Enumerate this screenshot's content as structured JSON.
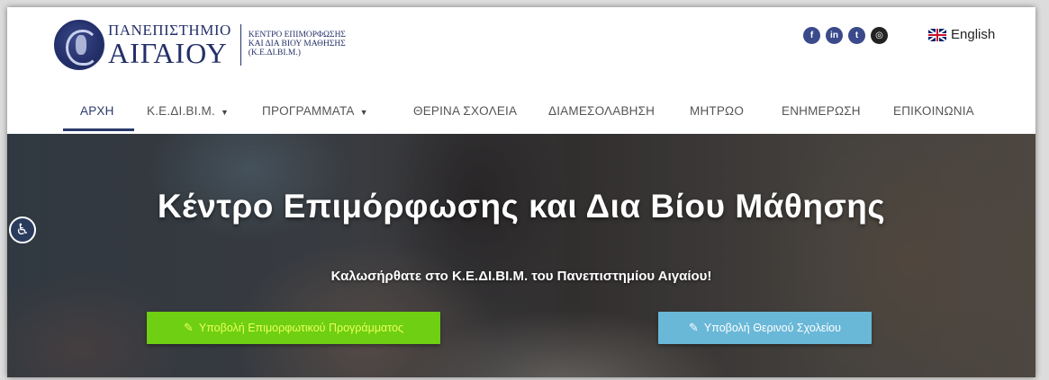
{
  "header": {
    "university_line1": "ΠΑΝΕΠΙΣΤΗΜΙΟ",
    "university_line2": "ΑΙΓΑΙΟΥ",
    "center_line1": "ΚΕΝΤΡΟ ΕΠΙΜΟΡΦΩΣΗΣ",
    "center_line2": "ΚΑΙ ΔΙΑ ΒΙΟΥ ΜΑΘΗΣΗΣ",
    "center_line3": "(Κ.Ε.ΔΙ.ΒΙ.Μ.)",
    "social": [
      {
        "icon": "facebook-icon",
        "glyph": "f"
      },
      {
        "icon": "linkedin-icon",
        "glyph": "in"
      },
      {
        "icon": "twitter-icon",
        "glyph": "t"
      },
      {
        "icon": "instagram-icon",
        "glyph": "◎"
      }
    ],
    "language_label": "English",
    "language_flag": "uk-flag-icon"
  },
  "nav": {
    "items": [
      {
        "label": "ΑΡΧΗ",
        "active": true,
        "dropdown": false
      },
      {
        "label": "Κ.Ε.ΔΙ.ΒΙ.Μ.",
        "active": false,
        "dropdown": true
      },
      {
        "label": "ΠΡΟΓΡΑΜΜΑΤΑ",
        "active": false,
        "dropdown": true
      },
      {
        "label": "ΘΕΡΙΝΑ ΣΧΟΛΕΙΑ",
        "active": false,
        "dropdown": false
      },
      {
        "label": "ΔΙΑΜΕΣΟΛΑΒΗΣΗ",
        "active": false,
        "dropdown": false
      },
      {
        "label": "ΜΗΤΡΩΟ",
        "active": false,
        "dropdown": false
      },
      {
        "label": "ΕΝΗΜΕΡΩΣΗ",
        "active": false,
        "dropdown": false
      },
      {
        "label": "ΕΠΙΚΟΙΝΩΝΙΑ",
        "active": false,
        "dropdown": false
      }
    ],
    "caret": "▼"
  },
  "hero": {
    "title": "Κέντρο Επιμόρφωσης και Δια Βίου Μάθησης",
    "subtitle": "Καλωσήρθατε στο Κ.Ε.ΔΙ.ΒΙ.Μ. του Πανεπιστημίου Αιγαίου!",
    "button_program": "Υποβολή Επιμορφωτικού Προγράμματος",
    "button_summer": "Υποβολή Θερινού Σχολείου",
    "button_icon": "✎"
  },
  "accessibility": {
    "icon": "accessibility-icon",
    "glyph": "♿"
  },
  "colors": {
    "brand_navy": "#24306a",
    "button_green": "#6fcf12",
    "button_green_text": "#e9ff5a",
    "button_blue": "#6ab8d8"
  }
}
